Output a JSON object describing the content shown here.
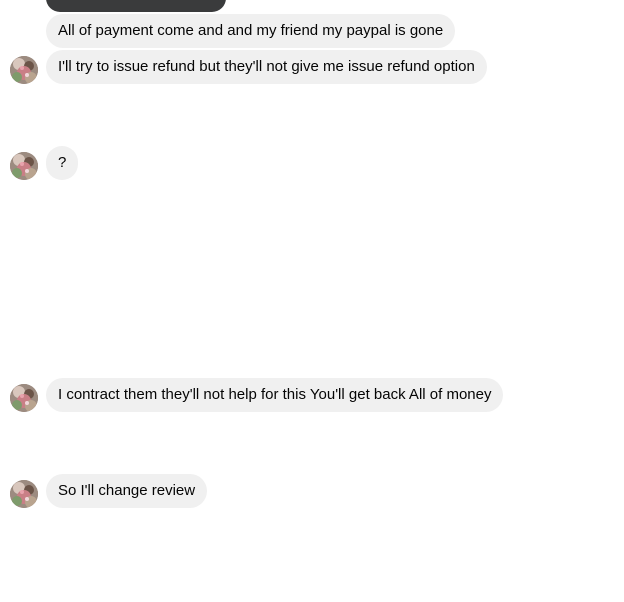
{
  "messages": [
    {
      "text": "All of payment come and and my friend my paypal is gone",
      "has_avatar": false
    },
    {
      "text": "I'll try to issue refund but they'll not give me issue refund option",
      "has_avatar": true
    },
    {
      "text": "?",
      "has_avatar": true
    },
    {
      "text": "I contract them they'll not help for this You'll get back All of money",
      "has_avatar": true
    },
    {
      "text": "So I'll change review",
      "has_avatar": true
    }
  ],
  "colors": {
    "incoming_bubble": "#f0f0f0",
    "outgoing_bubble": "#3a3b3c",
    "text": "#050505",
    "background": "#ffffff"
  },
  "icons": {
    "avatar": "contact-avatar-photo"
  }
}
